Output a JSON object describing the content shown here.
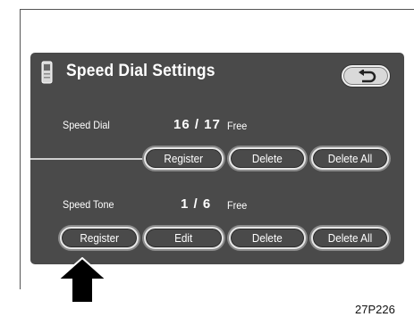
{
  "screen": {
    "title": "Speed Dial Settings",
    "back_icon": "back-arrow-icon"
  },
  "speed_dial": {
    "label": "Speed Dial",
    "count": "16 / 17",
    "free": "Free",
    "buttons": {
      "register": "Register",
      "delete": "Delete",
      "delete_all": "Delete All"
    }
  },
  "speed_tone": {
    "label": "Speed Tone",
    "count": "1 /  6",
    "free": "Free",
    "buttons": {
      "register": "Register",
      "edit": "Edit",
      "delete": "Delete",
      "delete_all": "Delete All"
    }
  },
  "figure": {
    "code": "27P226"
  },
  "colors": {
    "screen_bg": "#4a4a4a",
    "button_border": "#e6e6e6",
    "text": "#ffffff"
  }
}
